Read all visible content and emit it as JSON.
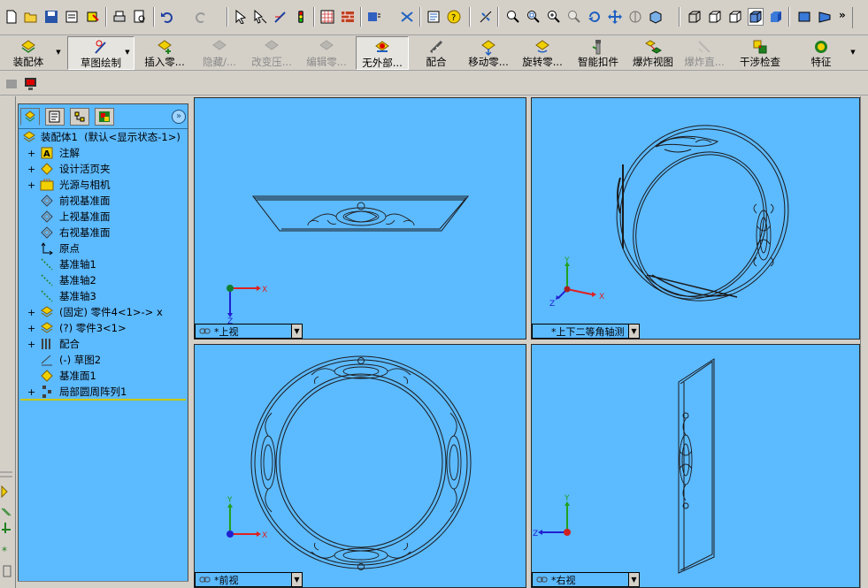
{
  "toolbar": {
    "overflow_label": "»",
    "icons": [
      "new-icon",
      "open-icon",
      "save-icon",
      "print-preview-icon",
      "rebuild-icon",
      "print-icon",
      "preview-icon",
      "undo-icon",
      "redo-icon",
      "select-icon",
      "select-face-icon",
      "sketch-icon",
      "traffic-light-icon",
      "grid-icon",
      "brick-icon",
      "filter-icon",
      "tools-icon",
      "properties-icon",
      "help-icon",
      "smart-dim-icon",
      "zoom-fit-icon",
      "zoom-area-icon",
      "zoom-in-icon",
      "zoom-out-icon",
      "rotate-icon",
      "pan-icon",
      "roll-icon",
      "view-orient-icon",
      "wireframe-icon",
      "hlr-icon",
      "hlv-icon",
      "shaded-edges-icon",
      "shaded-icon",
      "section-icon",
      "perspective-icon"
    ]
  },
  "command_manager": {
    "buttons": [
      {
        "id": "assembly",
        "label": "装配体",
        "state": "normal"
      },
      {
        "id": "sketch",
        "label": "草图绘制",
        "state": "pressed"
      },
      {
        "id": "insert-component",
        "label": "插入零...",
        "state": "normal"
      },
      {
        "id": "hide",
        "label": "隐藏/...",
        "state": "disabled"
      },
      {
        "id": "change-suppress",
        "label": "改变压...",
        "state": "disabled"
      },
      {
        "id": "edit-part",
        "label": "编辑零...",
        "state": "disabled"
      },
      {
        "id": "no-external",
        "label": "无外部...",
        "state": "pressed"
      },
      {
        "id": "mate",
        "label": "配合",
        "state": "normal"
      },
      {
        "id": "move-component",
        "label": "移动零...",
        "state": "normal"
      },
      {
        "id": "rotate-component",
        "label": "旋转零...",
        "state": "normal"
      },
      {
        "id": "smart-fastener",
        "label": "智能扣件",
        "state": "normal"
      },
      {
        "id": "exploded-view",
        "label": "爆炸视图",
        "state": "normal"
      },
      {
        "id": "explode-line",
        "label": "爆炸直...",
        "state": "disabled"
      },
      {
        "id": "interference",
        "label": "干涉检查",
        "state": "normal"
      },
      {
        "id": "features",
        "label": "特征",
        "state": "normal"
      }
    ]
  },
  "feature_manager": {
    "tabs": [
      "feature-tree-tab",
      "property-tab",
      "configuration-tab",
      "display-tab"
    ],
    "root": {
      "label": "装配体1",
      "config": "(默认<显示状态-1>)"
    },
    "items": [
      {
        "label": "注解",
        "expand": "+",
        "icon": "annotation"
      },
      {
        "label": "设计活页夹",
        "expand": "+",
        "icon": "binder"
      },
      {
        "label": "光源与相机",
        "expand": "+",
        "icon": "lights"
      },
      {
        "label": "前视基准面",
        "expand": "",
        "icon": "plane"
      },
      {
        "label": "上视基准面",
        "expand": "",
        "icon": "plane"
      },
      {
        "label": "右视基准面",
        "expand": "",
        "icon": "plane"
      },
      {
        "label": "原点",
        "expand": "",
        "icon": "origin"
      },
      {
        "label": "基准轴1",
        "expand": "",
        "icon": "axis"
      },
      {
        "label": "基准轴2",
        "expand": "",
        "icon": "axis"
      },
      {
        "label": "基准轴3",
        "expand": "",
        "icon": "axis"
      },
      {
        "label": "(固定) 零件4<1>-> x",
        "expand": "+",
        "icon": "part"
      },
      {
        "label": "(?) 零件3<1>",
        "expand": "+",
        "icon": "part"
      },
      {
        "label": "配合",
        "expand": "+",
        "icon": "mates"
      },
      {
        "label": "(-) 草图2",
        "expand": "",
        "icon": "sketch"
      },
      {
        "label": "基准面1",
        "expand": "",
        "icon": "plane-yellow"
      },
      {
        "label": "局部圆周阵列1",
        "expand": "+",
        "icon": "pattern"
      }
    ]
  },
  "viewports": {
    "top": {
      "label": "*上视"
    },
    "isometric": {
      "label": "*上下二等角轴测"
    },
    "front": {
      "label": "*前视"
    },
    "right": {
      "label": "*右视"
    }
  },
  "axes": {
    "x": "X",
    "y": "Y",
    "z": "Z"
  },
  "colors": {
    "viewport_bg": "#5cbaff",
    "chrome": "#d4d0c8",
    "axis_x": "#e02020",
    "axis_y": "#20a020",
    "axis_z": "#2020d0"
  }
}
